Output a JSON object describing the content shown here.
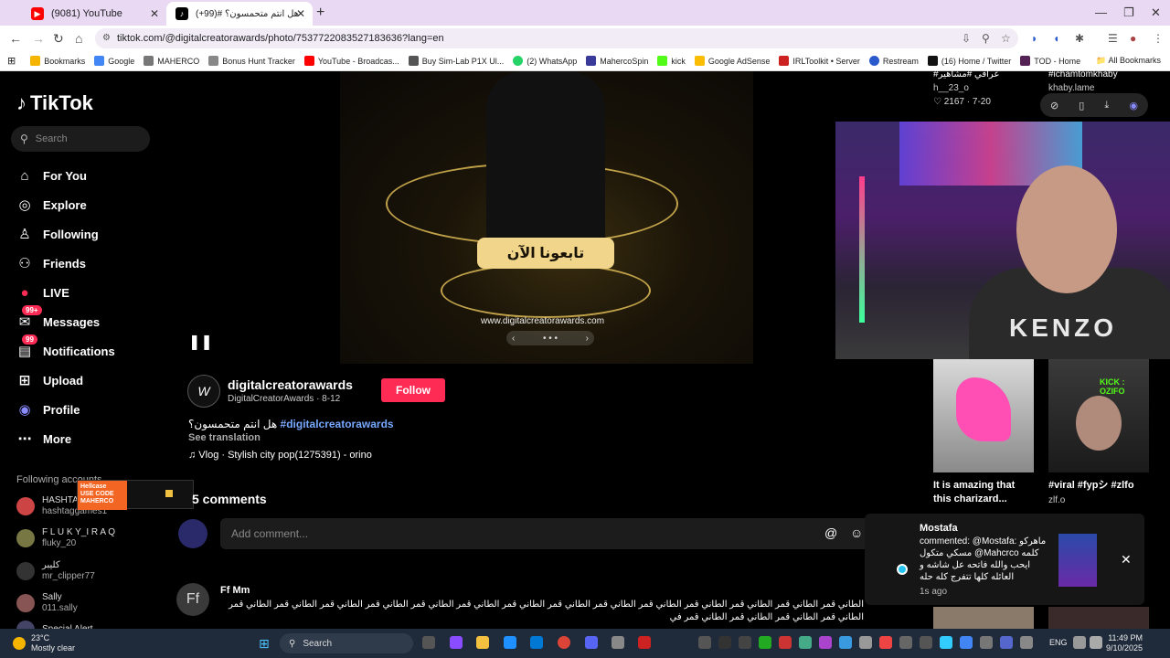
{
  "browser": {
    "tabs": [
      {
        "title": "(9081) YouTube",
        "icon": "youtube-icon",
        "active": false
      },
      {
        "title": "هل انتم متحمسون؟ #(99+)",
        "icon": "tiktok-icon",
        "active": true
      }
    ],
    "url": "tiktok.com/@digitalcreatorawards/photo/7537722083527183636?lang=en",
    "bookmarks": [
      {
        "label": "Bookmarks",
        "color": "#f4b400"
      },
      {
        "label": "Google",
        "color": "#4285f4"
      },
      {
        "label": "MAHERCO",
        "color": "#777"
      },
      {
        "label": "Bonus Hunt Tracker",
        "color": "#888"
      },
      {
        "label": "YouTube - Broadcas...",
        "color": "#ff0000"
      },
      {
        "label": "Buy Sim-Lab P1X Ul...",
        "color": "#555"
      },
      {
        "label": "(2) WhatsApp",
        "color": "#25d366"
      },
      {
        "label": "MahercoSpin",
        "color": "#3a3a9a"
      },
      {
        "label": "kick",
        "color": "#53fc18"
      },
      {
        "label": "Google AdSense",
        "color": "#fbbc04"
      },
      {
        "label": "IRLToolkit • Server",
        "color": "#cc2222"
      },
      {
        "label": "Restream",
        "color": "#2a5acc"
      },
      {
        "label": "(16) Home / Twitter",
        "color": "#111"
      },
      {
        "label": "TOD - Home",
        "color": "#552255"
      }
    ],
    "all_bookmarks": "All Bookmarks"
  },
  "sidebar": {
    "logo": "TikTok",
    "search_placeholder": "Search",
    "nav": [
      {
        "label": "For You",
        "icon": "home-icon",
        "glyph": "⌂"
      },
      {
        "label": "Explore",
        "icon": "compass-icon",
        "glyph": "◎"
      },
      {
        "label": "Following",
        "icon": "following-icon",
        "glyph": "♙"
      },
      {
        "label": "Friends",
        "icon": "friends-icon",
        "glyph": "⚇"
      },
      {
        "label": "LIVE",
        "icon": "live-icon",
        "glyph": "●"
      },
      {
        "label": "Messages",
        "icon": "messages-icon",
        "glyph": "✉",
        "badge": "99+"
      },
      {
        "label": "Notifications",
        "icon": "bell-icon",
        "glyph": "▤",
        "badge": "99"
      },
      {
        "label": "Upload",
        "icon": "upload-icon",
        "glyph": "⊞"
      },
      {
        "label": "Profile",
        "icon": "profile-icon",
        "glyph": "◉"
      },
      {
        "label": "More",
        "icon": "more-icon",
        "glyph": "⋯"
      }
    ],
    "following_accounts_label": "Following accounts",
    "accounts": [
      {
        "name": "HASHTA",
        "user": "hashtaggames1"
      },
      {
        "name": "F L U K Y_I R A Q",
        "user": "fluky_20"
      },
      {
        "name": "كليبر",
        "user": "mr_clipper77"
      },
      {
        "name": "Sally",
        "user": "011.sally"
      },
      {
        "name": "Special Alert",
        "user": ""
      }
    ]
  },
  "post": {
    "cta_text": "تابعونا الآن",
    "site_url": "www.digitalcreatorawards.com",
    "author_name": "digitalcreatorawards",
    "author_meta": "DigitalCreatorAwards · 8-12",
    "follow_label": "Follow",
    "caption_text": "هل انتم متحمسون؟",
    "caption_tag": "#digitalcreatorawards",
    "see_translation": "See translation",
    "music": "♫ Vlog · Stylish city pop(1275391) - orino"
  },
  "comments": {
    "count_label": "5 comments",
    "input_placeholder": "Add comment...",
    "items": [
      {
        "initials": "Ff",
        "user": "Ff Mm",
        "text": "الطاني قمر الطاني قمر الطاني قمر الطاني قمر الطاني قمر الطاني قمر الطاني قمر الطاني قمر الطاني قمر الطاني قمر الطاني قمر الطاني قمر الطاني قمر الطاني قمر الطاني قمر الطاني قمر الطاني قمر الطاني قمر في"
      }
    ]
  },
  "overlay": {
    "brand": "Hellcase",
    "code": "USE CODE MAHERCO"
  },
  "right_column": {
    "top_left": {
      "title": "#عراقي #مشاهير",
      "user": "h__23_o",
      "stats": "♡ 2167 · 7-20"
    },
    "top_right": {
      "title": "#ichamtomkhaby",
      "user": "khaby.lame"
    },
    "thumb1": {
      "title": "It is amazing that this charizard...",
      "sub": ""
    },
    "thumb2": {
      "title": "#viral #fypシ #zlfo",
      "sub": "zlf.o",
      "kick": "KICK : OZIFO"
    },
    "webcam_shirt": "KENZO"
  },
  "notification": {
    "name": "Mostafa",
    "text": "commented: @Mostafa: ماهركو مسكي متكول @Mahcrco كلمه ايحب والله فاتحه عل شاشه و العائله كلها تتفرج كله حله",
    "time": "1s ago"
  },
  "taskbar": {
    "temp": "23°C",
    "weather": "Mostly clear",
    "search": "Search",
    "lang": "ENG",
    "time": "11:49 PM",
    "date": "9/10/2025"
  }
}
